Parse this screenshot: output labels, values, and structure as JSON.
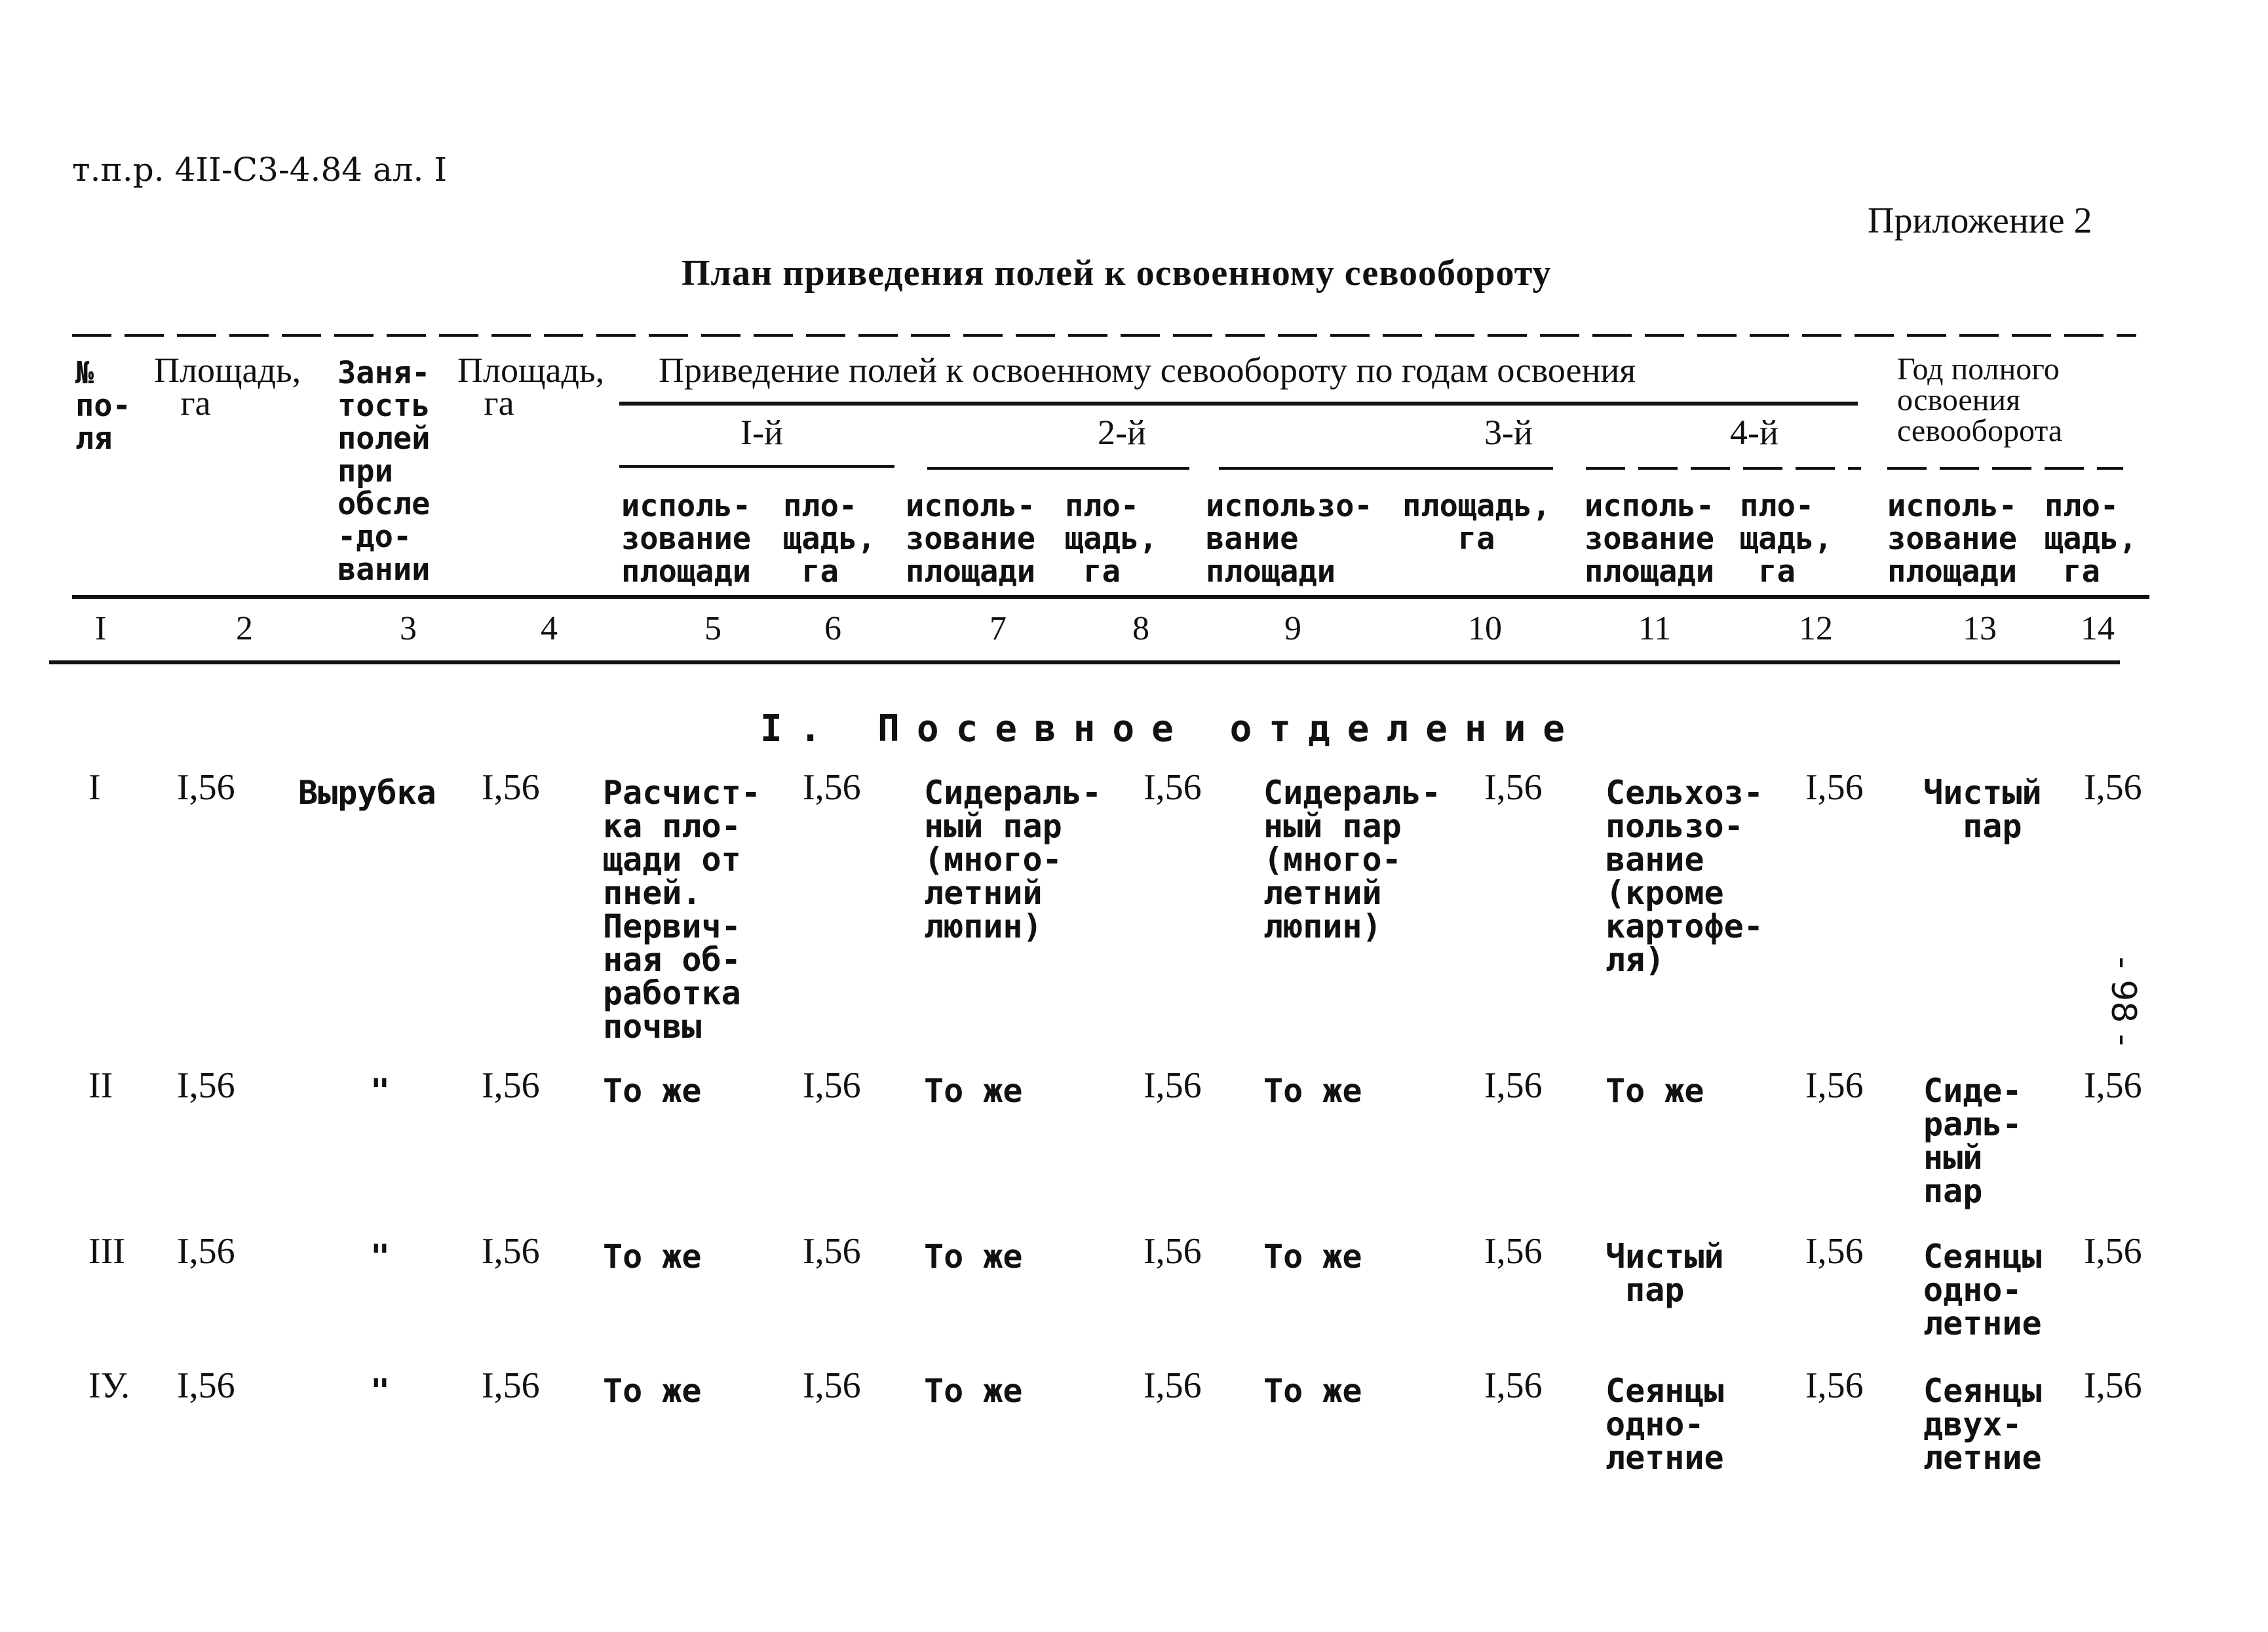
{
  "document": {
    "ref": "т.п.р. 4II-С3-4.84 ал. I",
    "appendix": "Приложение 2",
    "title": "План приведения полей к освоенному севообороту",
    "page_number": "- 98 -"
  },
  "header": {
    "c1": "№\nпо-\nля",
    "c2": "Площадь,\n   га",
    "c3": "Заня-\nтость\nполей\nпри\nобсле\n-до-\nвании",
    "c4": "Площадь,\n   га",
    "group": "Приведение полей к освоенному севообороту по годам освоения",
    "years": [
      "I-й",
      "2-й",
      "3-й",
      "4-й"
    ],
    "final": "Год полного\nосвоения\nсевооборота",
    "sub_use": "исполь-\nзование\nплощади",
    "sub_use_3": "использо-\nвание\nплощади",
    "sub_area": "пло-\nщадь,\n га",
    "sub_area_3": "площадь,\n   га",
    "column_numbers": [
      "I",
      "2",
      "3",
      "4",
      "5",
      "6",
      "7",
      "8",
      "9",
      "10",
      "11",
      "12",
      "13",
      "14"
    ]
  },
  "section": "I. Посевное отделение",
  "rows": [
    {
      "field": "I",
      "area": "I,56",
      "occupancy": "Вырубка",
      "area2": "I,56",
      "y1_use": "Расчист-\nка пло-\nщади от\nпней.\nПервич-\nная об-\nработка\nпочвы",
      "y1_area": "I,56",
      "y2_use": "Сидераль-\nный пар\n(много-\nлетний\nлюпин)",
      "y2_area": "I,56",
      "y3_use": "Сидераль-\nный пар\n(много-\nлетний\nлюпин)",
      "y3_area": "I,56",
      "y4_use": "Сельхоз-\nпользо-\nвание\n(кроме\nкартофе-\nля)",
      "y4_area": "I,56",
      "final_use": "Чистый\n  пар",
      "final_area": "I,56"
    },
    {
      "field": "II",
      "area": "I,56",
      "occupancy": "\"",
      "area2": "I,56",
      "y1_use": "То же",
      "y1_area": "I,56",
      "y2_use": "То же",
      "y2_area": "I,56",
      "y3_use": "То же",
      "y3_area": "I,56",
      "y4_use": "То же",
      "y4_area": "I,56",
      "final_use": "Сиде-\nраль-\nный\nпар",
      "final_area": "I,56"
    },
    {
      "field": "III",
      "area": "I,56",
      "occupancy": "\"",
      "area2": "I,56",
      "y1_use": "То же",
      "y1_area": "I,56",
      "y2_use": "То же",
      "y2_area": "I,56",
      "y3_use": "То же",
      "y3_area": "I,56",
      "y4_use": "Чистый\n пар",
      "y4_area": "I,56",
      "final_use": "Сеянцы\nодно-\nлетние",
      "final_area": "I,56"
    },
    {
      "field": "IУ.",
      "area": "I,56",
      "occupancy": "\"",
      "area2": "I,56",
      "y1_use": "То же",
      "y1_area": "I,56",
      "y2_use": "То же",
      "y2_area": "I,56",
      "y3_use": "То же",
      "y3_area": "I,56",
      "y4_use": "Сеянцы\nодно-\nлетние",
      "y4_area": "I,56",
      "final_use": "Сеянцы\nдвух-\nлетние",
      "final_area": "I,56"
    }
  ]
}
